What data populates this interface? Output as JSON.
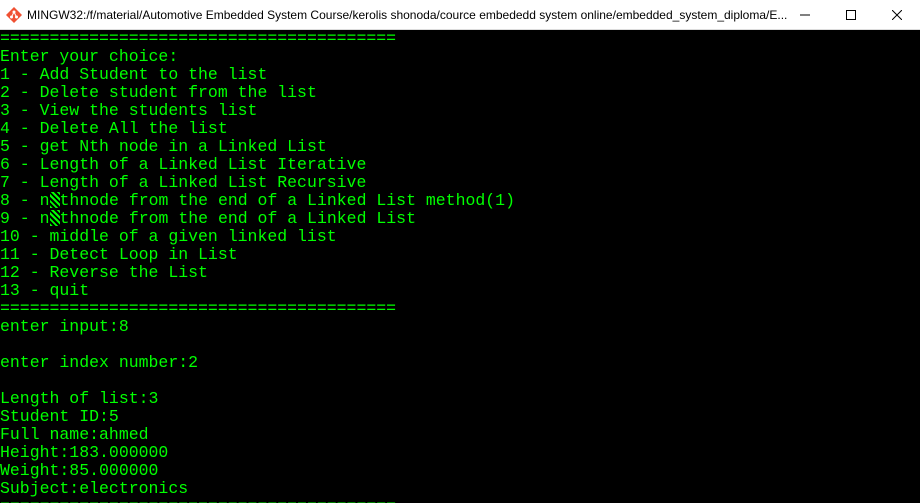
{
  "window": {
    "title": "MINGW32:/f/material/Automotive Embedded System Course/kerolis shonoda/cource embededd system online/embedded_system_diploma/E...",
    "icon": "git-bash-icon",
    "controls": [
      "minimize-icon",
      "maximize-icon",
      "close-icon"
    ]
  },
  "terminal": {
    "text_color": "#00ff00",
    "background": "#000000",
    "lines": [
      "========================================",
      "Enter your choice:",
      "1 - Add Student to the list",
      "2 - Delete student from the list",
      "3 - View the students list",
      "4 - Delete All the list",
      "5 - get Nth node in a Linked List",
      "6 - Length of a Linked List Iterative",
      "7 - Length of a Linked List Recursive",
      "8 - n",
      "9 - n",
      "10 - middle of a given linked list",
      "11 - Detect Loop in List",
      "12 - Reverse the List",
      "13 - quit",
      "========================================",
      "enter input:8",
      "",
      "enter index number:2",
      "",
      "Length of list:3",
      "Student ID:5",
      "Full name:ahmed",
      "Height:183.000000",
      "Weight:85.000000",
      "Subject:electronics",
      "========================================"
    ],
    "line8_tail": "thnode from the end of a Linked List method(1)",
    "line9_tail": "thnode from the end of a Linked List"
  }
}
